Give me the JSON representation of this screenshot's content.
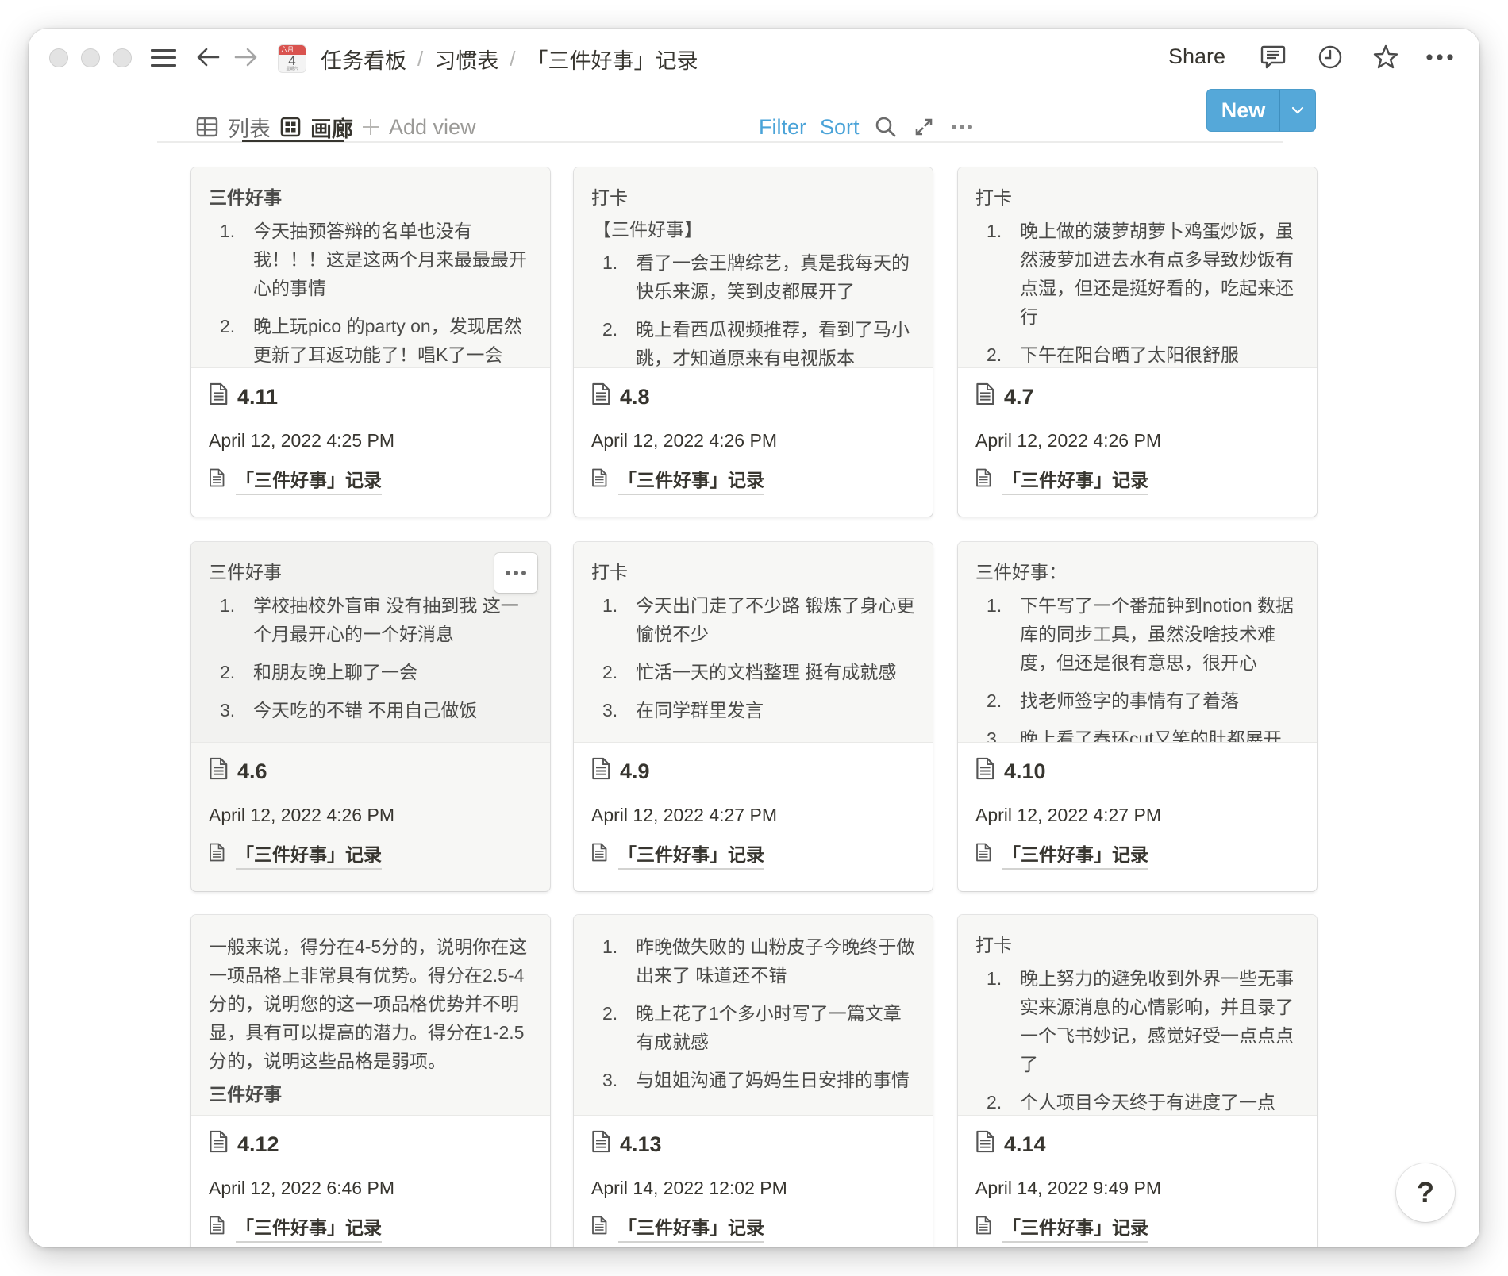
{
  "window": {
    "breadcrumb": [
      {
        "label": "任务看板",
        "icon": "calendar-icon"
      },
      {
        "label": "习惯表"
      },
      {
        "label": "「三件好事」记录"
      }
    ],
    "calendar_icon": {
      "month": "六月",
      "day": "4",
      "weekday": "星期六"
    },
    "breadcrumb_separator": "/",
    "actions": {
      "share_label": "Share",
      "icons": [
        "comment-icon",
        "clock-icon",
        "star-icon",
        "more-icon"
      ]
    }
  },
  "view_bar": {
    "tabs": [
      {
        "label": "列表",
        "icon": "table-icon",
        "active": false
      },
      {
        "label": "画廊",
        "icon": "gallery-icon",
        "active": true
      }
    ],
    "add_view_label": "Add view",
    "filter_label": "Filter",
    "sort_label": "Sort",
    "new_label": "New",
    "accent_color": "#4aa3d8",
    "new_button_color": "#55a8d9"
  },
  "cards": [
    {
      "title": "4.11",
      "date": "April 12, 2022 4:25 PM",
      "relation": "「三件好事」记录",
      "preview": {
        "heading": "三件好事",
        "heading_bold": true,
        "items": [
          "今天抽预答辩的名单也没有我！！！这是这两个月来最最最开心的事情",
          "晚上玩pico 的party on，发现居然更新了耳返功能了！唱K了一会"
        ]
      }
    },
    {
      "title": "4.8",
      "date": "April 12, 2022 4:26 PM",
      "relation": "「三件好事」记录",
      "preview": {
        "heading": "打卡",
        "subheading": "【三件好事】",
        "items": [
          "看了一会王牌综艺，真是我每天的快乐来源，笑到皮都展开了",
          "晚上看西瓜视频推荐，看到了马小跳，才知道原来有电视版本"
        ]
      }
    },
    {
      "title": "4.7",
      "date": "April 12, 2022 4:26 PM",
      "relation": "「三件好事」记录",
      "preview": {
        "heading": "打卡",
        "items": [
          "晚上做的菠萝胡萝卜鸡蛋炒饭，虽然菠萝加进去水有点多导致炒饭有点湿，但还是挺好看的，吃起来还行",
          "下午在阳台晒了太阳很舒服"
        ]
      }
    },
    {
      "title": "4.6",
      "date": "April 12, 2022 4:26 PM",
      "relation": "「三件好事」记录",
      "hovered": true,
      "preview": {
        "heading": "三件好事",
        "items": [
          "学校抽校外盲审 没有抽到我 这一个月最开心的一个好消息",
          "和朋友晚上聊了一会",
          "今天吃的不错 不用自己做饭"
        ]
      }
    },
    {
      "title": "4.9",
      "date": "April 12, 2022 4:27 PM",
      "relation": "「三件好事」记录",
      "preview": {
        "heading": "打卡",
        "items": [
          "今天出门走了不少路 锻炼了身心更愉悦不少",
          "忙活一天的文档整理 挺有成就感",
          "在同学群里发言"
        ]
      }
    },
    {
      "title": "4.10",
      "date": "April 12, 2022 4:27 PM",
      "relation": "「三件好事」记录",
      "preview": {
        "heading": "三件好事：",
        "items": [
          "下午写了一个番茄钟到notion 数据库的同步工具，虽然没啥技术难度，但还是很有意思，很开心",
          "找老师签字的事情有了着落",
          "晚上看了春环cut又笑的肚都展开了"
        ]
      }
    },
    {
      "title": "4.12",
      "date": "April 12, 2022 6:46 PM",
      "relation": "「三件好事」记录",
      "preview": {
        "paragraph": "一般来说，得分在4-5分的，说明你在这一项品格上非常具有优势。得分在2.5-4分的，说明您的这一项品格优势并不明显，具有可以提高的潜力。得分在1-2.5分的，说明这些品格是弱项。",
        "heading_after": "三件好事",
        "heading_bold": true
      }
    },
    {
      "title": "4.13",
      "date": "April 14, 2022 12:02 PM",
      "relation": "「三件好事」记录",
      "preview": {
        "items": [
          "昨晚做失败的 山粉皮子今晚终于做出来了 味道还不错",
          "晚上花了1个多小时写了一篇文章有成就感",
          "与姐姐沟通了妈妈生日安排的事情"
        ]
      }
    },
    {
      "title": "4.14",
      "date": "April 14, 2022 9:49 PM",
      "relation": "「三件好事」记录",
      "preview": {
        "heading": "打卡",
        "items": [
          "晚上努力的避免收到外界一些无事实来源消息的心情影响，并且录了一个飞书妙记，感觉好受一点点点了",
          "个人项目今天终于有进度了一点"
        ]
      }
    }
  ],
  "help_label": "?"
}
